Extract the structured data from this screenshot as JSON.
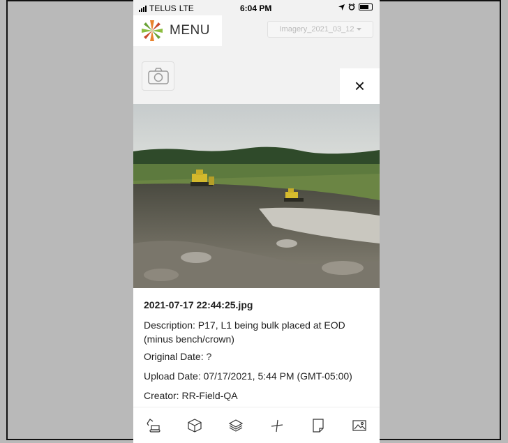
{
  "status_bar": {
    "carrier": "TELUS",
    "network": "LTE",
    "time": "6:04 PM"
  },
  "header": {
    "menu_label": "MENU",
    "imagery_select": "Imagery_2021_03_12"
  },
  "close_label": "×",
  "photo_info": {
    "filename": "2021-07-17 22:44:25.jpg",
    "description": "Description: P17, L1 being bulk placed at EOD (minus bench/crown)",
    "original_date": "Original Date: ?",
    "upload_date": "Upload Date: 07/17/2021, 5:44 PM (GMT-05:00)",
    "creator": "Creator: RR-Field-QA"
  },
  "toolbar_icons": [
    "excavator-icon",
    "cube-icon",
    "layers-icon",
    "measure-icon",
    "note-icon",
    "image-icon"
  ],
  "colors": {
    "background": "#b9b9b9",
    "panel": "#ffffff",
    "app_bg": "#f2f2f2",
    "logo_green": "#8cbd3f",
    "logo_orange": "#e9832d"
  }
}
